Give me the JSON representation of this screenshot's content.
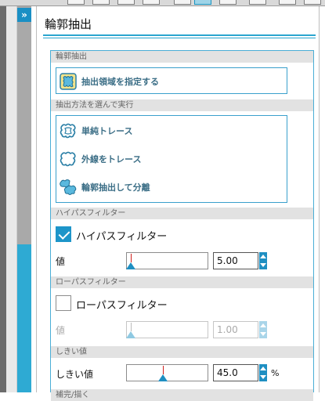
{
  "panel": {
    "title": "輪郭抽出"
  },
  "sections": {
    "extract": "輪郭抽出",
    "method": "抽出方法を選んで実行",
    "highpass": "ハイパスフィルター",
    "lowpass": "ローパスフィルター",
    "threshold": "しきい値",
    "next": "補完/描く"
  },
  "tools": {
    "specify_area": "抽出領域を指定する",
    "simple_trace": "単純トレース",
    "outline_trace": "外線をトレース",
    "extract_separate": "輪郭抽出して分離"
  },
  "highpass": {
    "checkbox_label": "ハイパスフィルター",
    "checked": true,
    "value_label": "値",
    "value": "5.00",
    "slider_level": 0.05
  },
  "lowpass": {
    "checkbox_label": "ローパスフィルター",
    "checked": false,
    "value_label": "値",
    "value": "1.00",
    "slider_level": 0.05
  },
  "threshold": {
    "value_label": "しきい値",
    "value": "45.0",
    "unit": "%",
    "slider_level": 0.45
  },
  "colors": {
    "accent": "#1f8fc2",
    "border": "#4aaed6",
    "section_bg": "#e2e2e2"
  }
}
